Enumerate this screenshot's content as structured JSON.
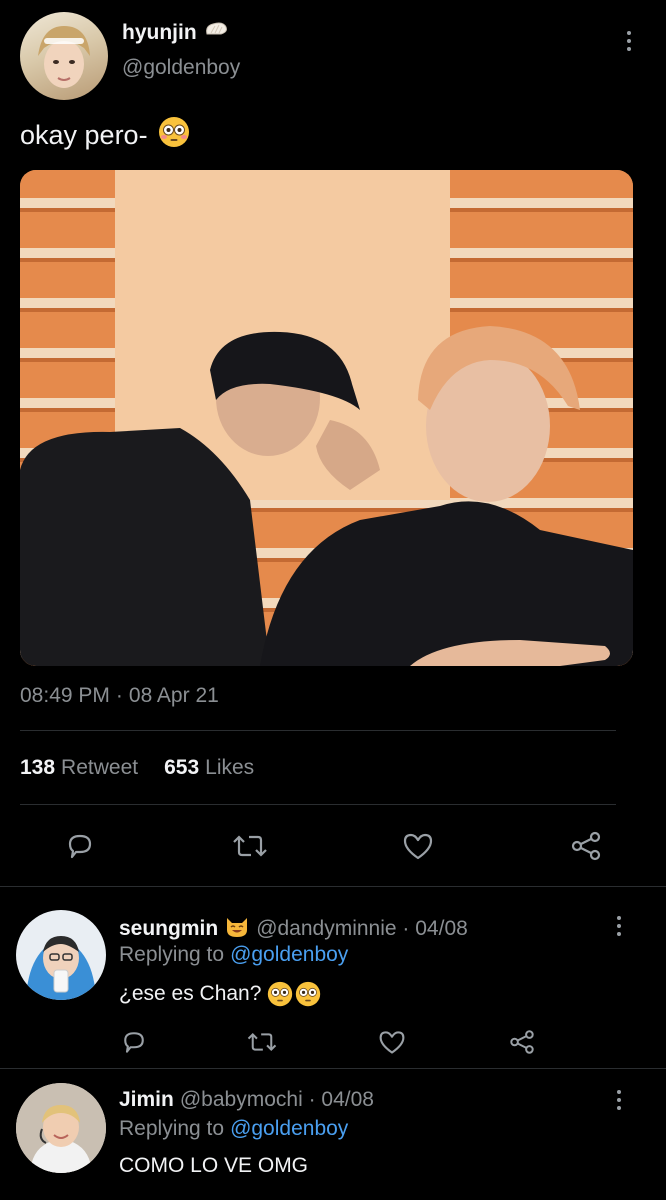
{
  "tweet": {
    "display_name": "hyunjin",
    "name_emoji": "bread-icon",
    "handle": "@goldenboy",
    "text": "okay pero-",
    "text_emoji": "flushed-face-icon",
    "time": "08:49 PM",
    "date_sep": "·",
    "date": "08 Apr 21",
    "retweet_count": "138",
    "retweet_label": "Retweet",
    "likes_count": "653",
    "likes_label": "Likes"
  },
  "replies": [
    {
      "display_name": "seungmin",
      "name_emoji": "smiling-cat-icon",
      "handle_meta": "@dandyminnie · 04/08",
      "replying_label": "Replying to",
      "replying_handle": "@goldenboy",
      "text": "¿ese es Chan?",
      "text_emojis": [
        "flushed-face-icon",
        "flushed-face-icon"
      ]
    },
    {
      "display_name": "Jimin",
      "handle_meta": "@babymochi · 04/08",
      "replying_label": "Replying to",
      "replying_handle": "@goldenboy",
      "text": "COMO LO VE OMG"
    }
  ],
  "colors": {
    "background": "#000000",
    "link": "#4a9ff0",
    "muted": "#8b8f93",
    "divider": "#2a2d30"
  }
}
